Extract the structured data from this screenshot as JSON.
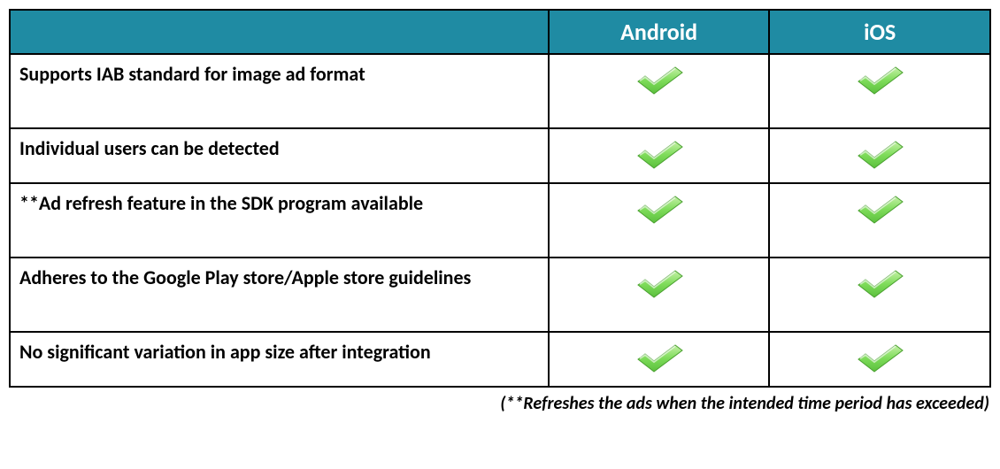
{
  "table": {
    "headers": {
      "feature": "",
      "android": "Android",
      "ios": "iOS"
    },
    "rows": [
      {
        "feature": "Supports IAB standard for image ad format",
        "android": true,
        "ios": true,
        "tall": true
      },
      {
        "feature": "Individual users can be detected",
        "android": true,
        "ios": true,
        "tall": false
      },
      {
        "feature": "**Ad refresh feature in the SDK program available",
        "android": true,
        "ios": true,
        "tall": true
      },
      {
        "feature": "Adheres to the Google Play store/Apple store guidelines",
        "android": true,
        "ios": true,
        "tall": true
      },
      {
        "feature": "No significant variation in app size after integration",
        "android": true,
        "ios": true,
        "tall": false
      }
    ]
  },
  "footnote": "(**Refreshes the ads when the intended time period has exceeded)",
  "colors": {
    "headerBg": "#1f8ba3",
    "headerText": "#ffffff",
    "border": "#000000",
    "check1": "#7edc5a",
    "check2": "#5bbf3d"
  }
}
